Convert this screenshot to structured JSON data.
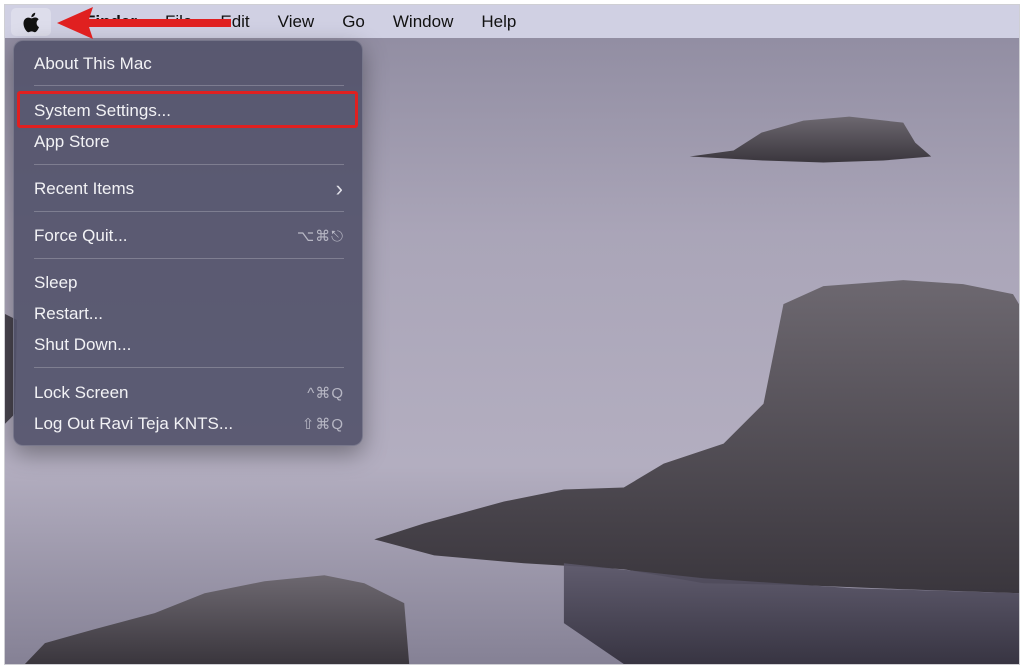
{
  "menubar": {
    "app_name": "Finder",
    "items": [
      "File",
      "Edit",
      "View",
      "Go",
      "Window",
      "Help"
    ]
  },
  "apple_menu": {
    "items": [
      {
        "label": "About This Mac",
        "shortcut": ""
      },
      {
        "label": "System Settings...",
        "shortcut": ""
      },
      {
        "label": "App Store",
        "shortcut": ""
      },
      {
        "label": "Recent Items",
        "shortcut": "›"
      },
      {
        "label": "Force Quit...",
        "shortcut": "⌥⌘⎋"
      },
      {
        "label": "Sleep",
        "shortcut": ""
      },
      {
        "label": "Restart...",
        "shortcut": ""
      },
      {
        "label": "Shut Down...",
        "shortcut": ""
      },
      {
        "label": "Lock Screen",
        "shortcut": "^⌘Q"
      },
      {
        "label": "Log Out Ravi Teja KNTS...",
        "shortcut": "⇧⌘Q"
      }
    ]
  },
  "icons": {
    "apple": "apple-logo-icon",
    "annotation": "red-arrow-icon"
  },
  "colors": {
    "annotation_red": "#e02020",
    "menu_bg": "#52526a",
    "menubar_bg": "#d6d6e8"
  }
}
